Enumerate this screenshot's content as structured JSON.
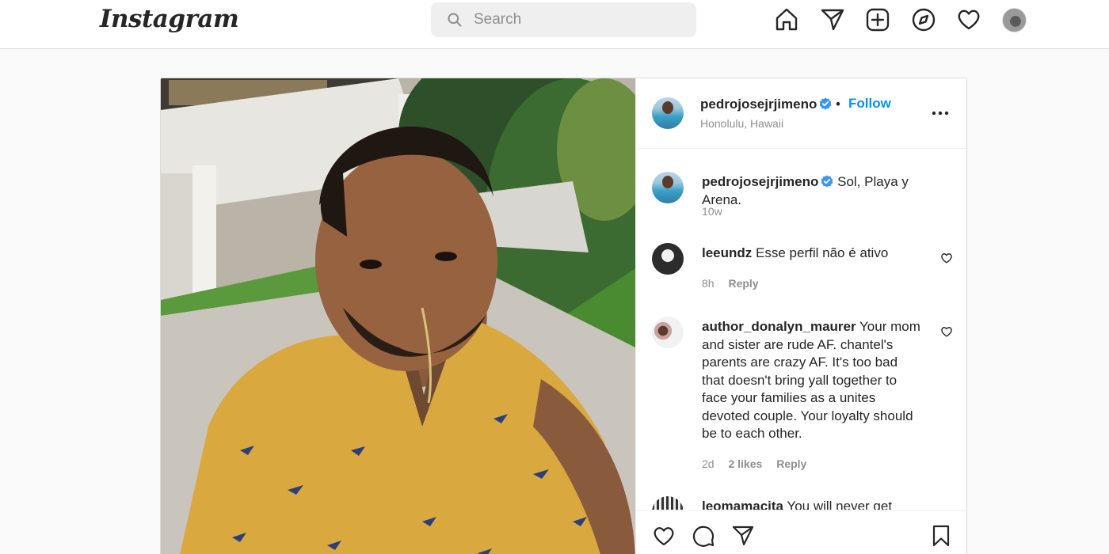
{
  "nav": {
    "logo": "Instagram",
    "search_placeholder": "Search",
    "icons": [
      "home-icon",
      "direct-message-icon",
      "new-post-icon",
      "explore-icon",
      "activity-heart-icon",
      "profile-avatar"
    ]
  },
  "post": {
    "author": "pedrojosejrjimeno",
    "follow_label": "Follow",
    "separator": "•",
    "location": "Honolulu, Hawaii",
    "caption": {
      "username": "pedrojosejrjimeno",
      "text": "Sol, Playa y Arena.",
      "time": "10w"
    },
    "comments": [
      {
        "username": "leeundz",
        "text": "Esse perfil não é ativo",
        "time": "8h",
        "likes": "",
        "reply_label": "Reply"
      },
      {
        "username": "author_donalyn_maurer",
        "text": "Your mom and sister are rude AF. chantel's parents are crazy AF. It's too bad that doesn't bring yall together to face your families as a unites devoted couple. Your loyalty should be to each other.",
        "time": "2d",
        "likes": "2 likes",
        "reply_label": "Reply"
      },
      {
        "username": "leomamacita",
        "text": "You will never get"
      }
    ],
    "actions": [
      "like-icon",
      "comment-icon",
      "share-icon",
      "save-icon"
    ]
  },
  "colors": {
    "accent": "#0095f6",
    "verified": "#3897f0",
    "muted_text": "#8e8e8e",
    "border": "#dbdbdb",
    "page_bg": "#fafafa"
  }
}
